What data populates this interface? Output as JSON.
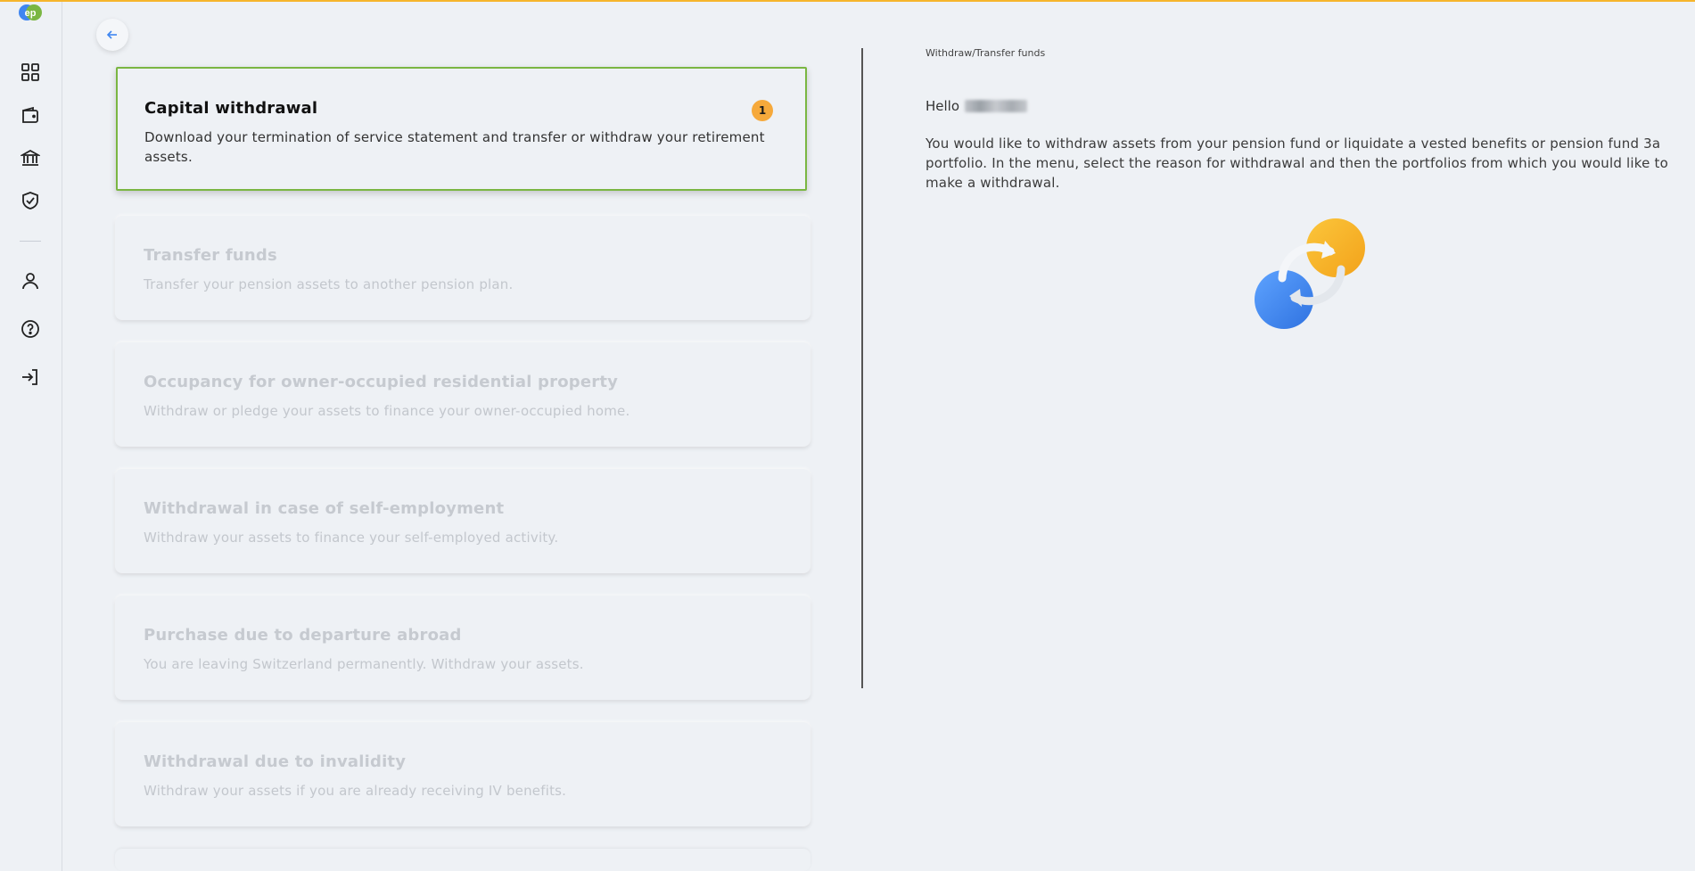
{
  "sidebar": {
    "logo_text": "ep",
    "items": [
      {
        "icon": "dashboard-icon"
      },
      {
        "icon": "wallet-icon"
      },
      {
        "icon": "bank-icon"
      },
      {
        "icon": "shield-check-icon"
      },
      {
        "icon": "user-icon"
      },
      {
        "icon": "help-icon"
      },
      {
        "icon": "logout-icon"
      }
    ]
  },
  "back_button": {
    "icon": "arrow-left-icon"
  },
  "cards": [
    {
      "title": "Capital withdrawal",
      "desc": "Download your termination of service statement and transfer or withdraw your retirement assets.",
      "badge": "1",
      "active": true
    },
    {
      "title": "Transfer funds",
      "desc": "Transfer your pension assets to another pension plan.",
      "active": false
    },
    {
      "title": "Occupancy for owner-occupied residential property",
      "desc": "Withdraw or pledge your assets to finance your owner-occupied home.",
      "active": false
    },
    {
      "title": "Withdrawal in case of self-employment",
      "desc": "Withdraw your assets to finance your self-employed activity.",
      "active": false
    },
    {
      "title": "Purchase due to departure abroad",
      "desc": "You are leaving Switzerland permanently. Withdraw your assets.",
      "active": false
    },
    {
      "title": "Withdrawal due to invalidity",
      "desc": "Withdraw your assets if you are already receiving IV benefits.",
      "active": false
    }
  ],
  "right_panel": {
    "breadcrumb": "Withdraw/Transfer funds",
    "greeting": "Hello",
    "intro": "You would like to withdraw assets from your pension fund or liquidate a vested benefits or pension fund 3a portfolio. In the menu, select the reason for withdrawal and then the portfolios from which you would like to make a withdrawal."
  },
  "colors": {
    "accent_top": "#f6b52c",
    "active_border": "#7ab642",
    "badge": "#f6a93b",
    "illustration_orange": "#f7b52a",
    "illustration_blue": "#3f86f0"
  }
}
